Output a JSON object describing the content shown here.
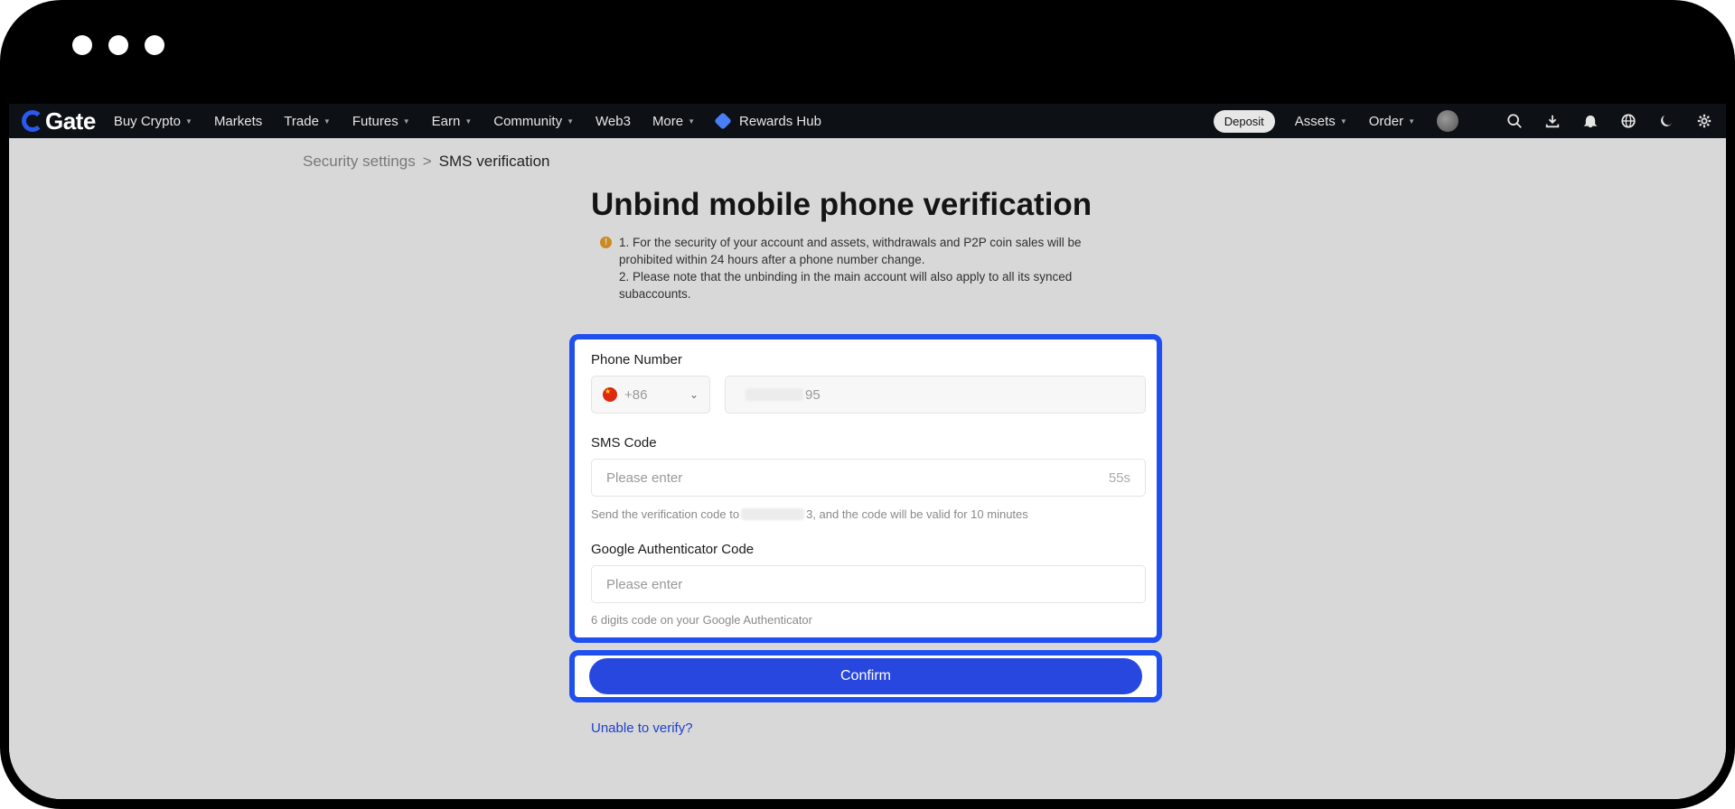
{
  "nav": {
    "logo_text": "Gate",
    "items": [
      {
        "label": "Buy Crypto",
        "dropdown": true
      },
      {
        "label": "Markets",
        "dropdown": false
      },
      {
        "label": "Trade",
        "dropdown": true
      },
      {
        "label": "Futures",
        "dropdown": true
      },
      {
        "label": "Earn",
        "dropdown": true
      },
      {
        "label": "Community",
        "dropdown": true
      },
      {
        "label": "Web3",
        "dropdown": false
      },
      {
        "label": "More",
        "dropdown": true
      }
    ],
    "rewards_label": "Rewards Hub",
    "deposit_label": "Deposit",
    "assets_label": "Assets",
    "order_label": "Order",
    "icons": [
      "search-icon",
      "download-icon",
      "bell-icon",
      "globe-icon",
      "moon-icon",
      "gear-icon"
    ]
  },
  "breadcrumb": {
    "parent": "Security settings",
    "separator": ">",
    "current": "SMS verification"
  },
  "page_title": "Unbind mobile phone verification",
  "notice": {
    "line1": "1. For the security of your account and assets, withdrawals and P2P coin sales will be prohibited within 24 hours after a phone number change.",
    "line2": "2. Please note that the unbinding in the main account will also apply to all its synced subaccounts."
  },
  "form": {
    "phone_label": "Phone Number",
    "country_code": "+86",
    "phone_value_suffix": "95",
    "sms_label": "SMS Code",
    "sms_placeholder": "Please enter",
    "sms_countdown": "55s",
    "sms_hint_prefix": "Send the verification code to",
    "sms_hint_suffix": "3, and the code will be valid for 10 minutes",
    "ga_label": "Google Authenticator Code",
    "ga_placeholder": "Please enter",
    "ga_hint": "6 digits code on your Google Authenticator"
  },
  "confirm_label": "Confirm",
  "unable_link": "Unable to verify?",
  "colors": {
    "accent": "#2747df",
    "highlight": "#1f4ff0",
    "warning": "#f0a020"
  }
}
